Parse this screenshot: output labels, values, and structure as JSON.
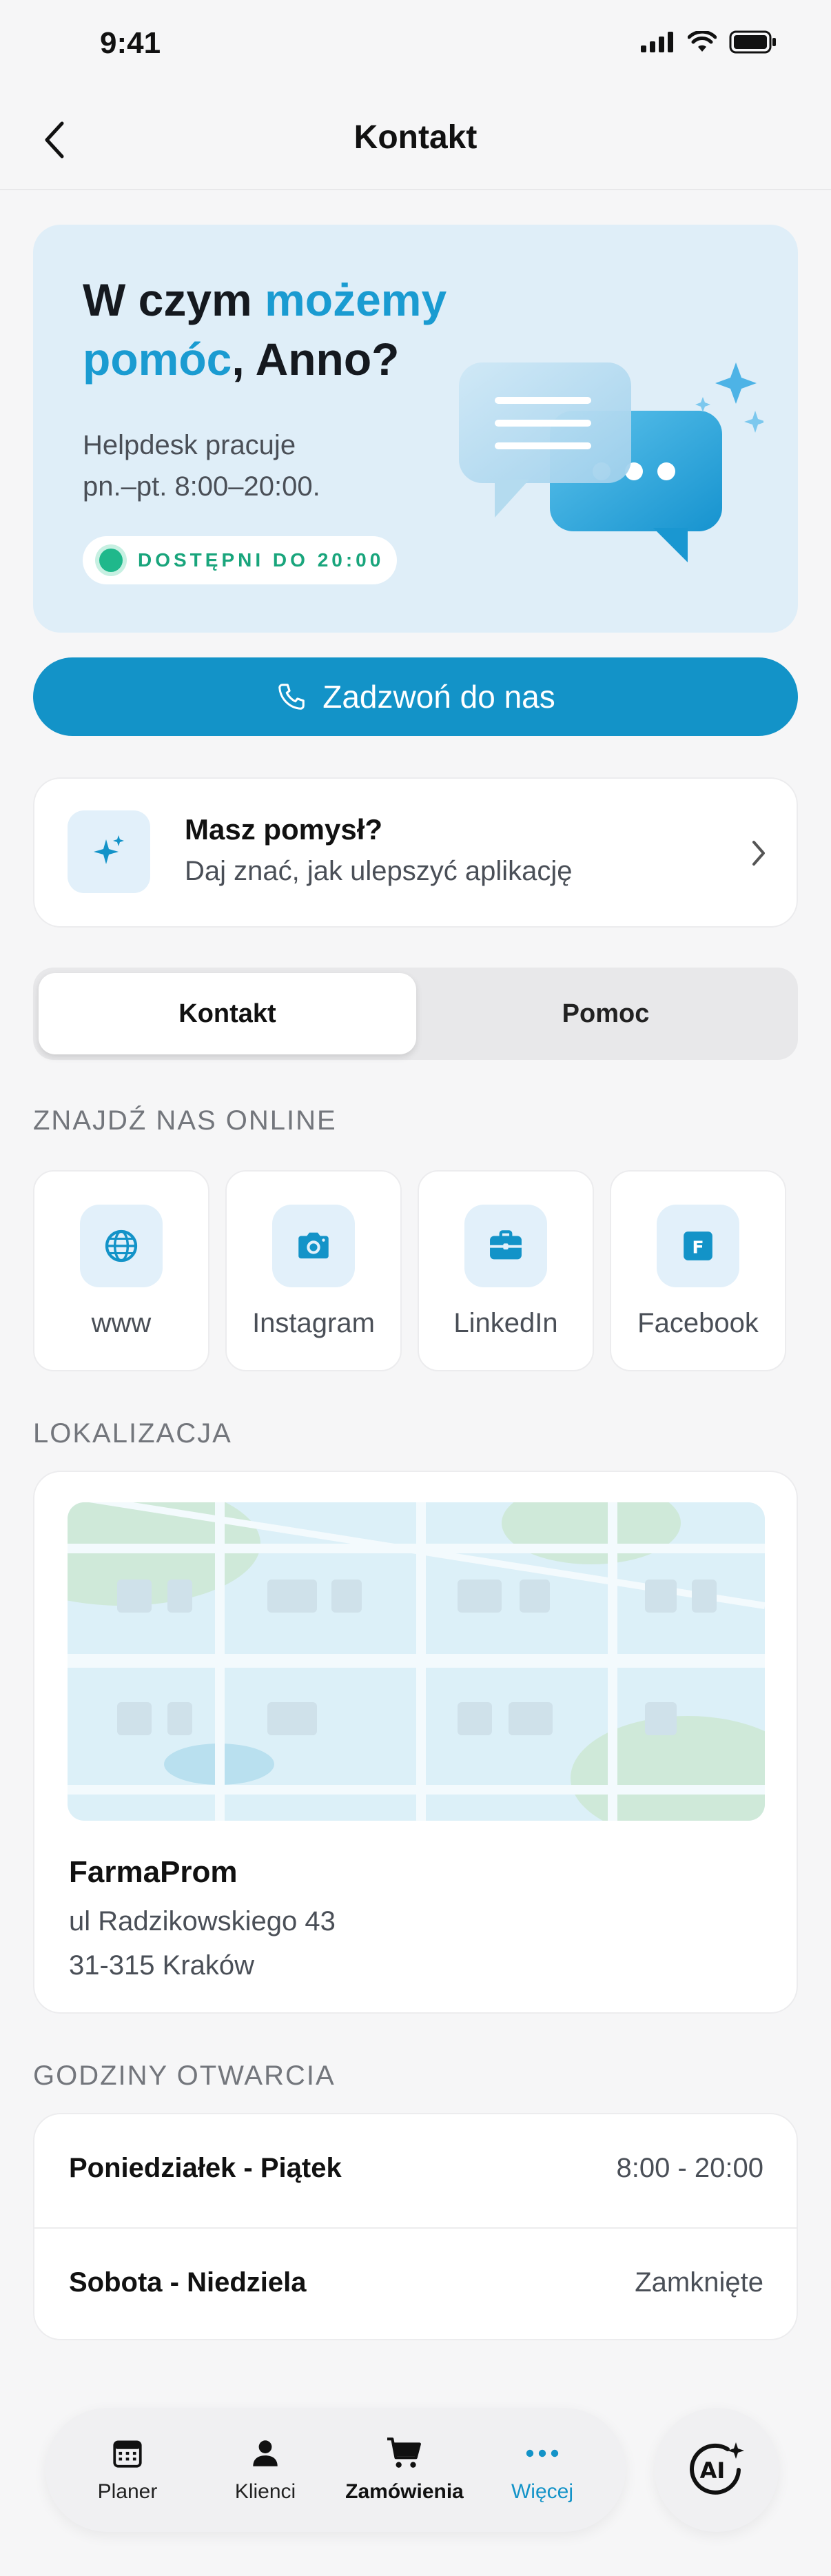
{
  "status_bar": {
    "time": "9:41"
  },
  "header": {
    "title": "Kontakt",
    "back_icon": "chevron-left-icon"
  },
  "hero": {
    "title_part1": "W czym ",
    "title_accent1": "możemy",
    "title_accent2": "pomóc",
    "title_part2": ", Anno?",
    "description": "Helpdesk pracuje\npn.–pt. 8:00–20:00.",
    "availability": "DOSTĘPNI DO 20:00",
    "accent_color": "#1a9bd1",
    "status_color": "#1fb88b"
  },
  "call_button": {
    "label": "Zadzwoń do nas",
    "icon": "phone-icon",
    "color": "#1393c8"
  },
  "idea_card": {
    "title": "Masz pomysł?",
    "subtitle": "Daj znać, jak ulepszyć aplikację",
    "icon": "sparkles-icon"
  },
  "segmented": {
    "active": "Kontakt",
    "inactive": "Pomoc"
  },
  "socials": {
    "section_label": "ZNAJDŹ NAS ONLINE",
    "items": [
      {
        "label": "www",
        "icon": "globe-icon"
      },
      {
        "label": "Instagram",
        "icon": "camera-icon"
      },
      {
        "label": "LinkedIn",
        "icon": "briefcase-icon"
      },
      {
        "label": "Facebook",
        "icon": "facebook-icon"
      }
    ]
  },
  "location": {
    "section_label": "LOKALIZACJA",
    "name": "FarmaProm",
    "address": "ul Radzikowskiego 43\n31-315 Kraków"
  },
  "hours": {
    "section_label": "GODZINY OTWARCIA",
    "rows": [
      {
        "day": "Poniedziałek - Piątek",
        "value": "8:00 - 20:00"
      },
      {
        "day": "Sobota - Niedziela",
        "value": "Zamknięte"
      }
    ]
  },
  "bottom_nav": {
    "items": [
      {
        "label": "Planer",
        "icon": "calendar-icon"
      },
      {
        "label": "Klienci",
        "icon": "person-icon"
      },
      {
        "label": "Zamówienia",
        "icon": "cart-icon"
      },
      {
        "label": "Więcej",
        "icon": "more-dots-icon"
      }
    ],
    "active": "Więcej",
    "ai_button": "ai-sparkle-icon"
  }
}
